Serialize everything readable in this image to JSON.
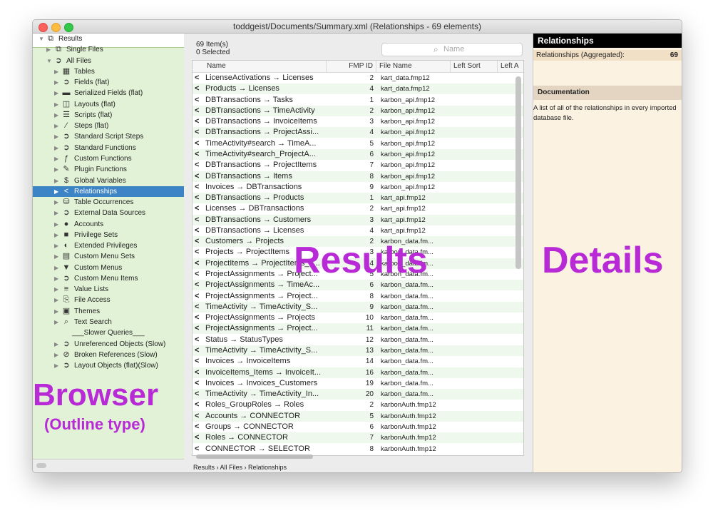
{
  "window": {
    "title": "toddgeist/Documents/Summary.xml  (Relationships - 69 elements)"
  },
  "browser": {
    "items": [
      {
        "label": "Results",
        "icon": "layers-icon",
        "indent": 0,
        "tri": "▼"
      },
      {
        "label": "Single Files",
        "icon": "layers-icon",
        "indent": 1,
        "tri": "▶"
      },
      {
        "label": "All Files",
        "icon": "circle-arrow-icon",
        "indent": 1,
        "tri": "▼"
      },
      {
        "label": "Tables",
        "icon": "table-icon",
        "indent": 2,
        "tri": "▶"
      },
      {
        "label": "Fields (flat)",
        "icon": "circle-arrow-icon",
        "indent": 2,
        "tri": "▶"
      },
      {
        "label": "Serialized Fields (flat)",
        "icon": "field-icon",
        "indent": 2,
        "tri": "▶"
      },
      {
        "label": "Layouts (flat)",
        "icon": "layout-icon",
        "indent": 2,
        "tri": "▶"
      },
      {
        "label": "Scripts (flat)",
        "icon": "script-icon",
        "indent": 2,
        "tri": "▶"
      },
      {
        "label": "Steps (flat)",
        "icon": "pen-icon",
        "indent": 2,
        "tri": "▶"
      },
      {
        "label": "Standard Script Steps",
        "icon": "circle-arrow-icon",
        "indent": 2,
        "tri": "▶"
      },
      {
        "label": "Standard Functions",
        "icon": "circle-arrow-icon",
        "indent": 2,
        "tri": "▶"
      },
      {
        "label": "Custom Functions",
        "icon": "function-icon",
        "indent": 2,
        "tri": "▶"
      },
      {
        "label": "Plugin Functions",
        "icon": "plugin-icon",
        "indent": 2,
        "tri": "▶"
      },
      {
        "label": "Global Variables",
        "icon": "dollar-icon",
        "indent": 2,
        "tri": "▶"
      },
      {
        "label": "Relationships",
        "icon": "relationship-icon",
        "indent": 2,
        "tri": "▶",
        "selected": true
      },
      {
        "label": "Table Occurrences",
        "icon": "database-icon",
        "indent": 2,
        "tri": "▶"
      },
      {
        "label": "External Data Sources",
        "icon": "circle-arrow-icon",
        "indent": 2,
        "tri": "▶"
      },
      {
        "label": "Accounts",
        "icon": "person-icon",
        "indent": 2,
        "tri": "▶"
      },
      {
        "label": "Privilege Sets",
        "icon": "lock-icon",
        "indent": 2,
        "tri": "▶"
      },
      {
        "label": "Extended Privileges",
        "icon": "toggle-icon",
        "indent": 2,
        "tri": "▶"
      },
      {
        "label": "Custom Menu Sets",
        "icon": "menu-set-icon",
        "indent": 2,
        "tri": "▶"
      },
      {
        "label": "Custom Menus",
        "icon": "chevron-down-icon",
        "indent": 2,
        "tri": "▶"
      },
      {
        "label": "Custom Menu Items",
        "icon": "circle-arrow-icon",
        "indent": 2,
        "tri": "▶"
      },
      {
        "label": "Value Lists",
        "icon": "list-icon",
        "indent": 2,
        "tri": "▶"
      },
      {
        "label": "File Access",
        "icon": "file-access-icon",
        "indent": 2,
        "tri": "▶"
      },
      {
        "label": "Themes",
        "icon": "theme-icon",
        "indent": 2,
        "tri": "▶"
      },
      {
        "label": "Text Search",
        "icon": "search-icon",
        "indent": 2,
        "tri": "▶"
      },
      {
        "label": "___Slower Queries___",
        "icon": "",
        "indent": 3,
        "tri": ""
      },
      {
        "label": "Unreferenced Objects (Slow)",
        "icon": "circle-arrow-icon",
        "indent": 2,
        "tri": "▶"
      },
      {
        "label": "Broken References (Slow)",
        "icon": "broken-icon",
        "indent": 2,
        "tri": "▶"
      },
      {
        "label": "Layout Objects (flat)(Slow)",
        "icon": "circle-arrow-icon",
        "indent": 2,
        "tri": "▶"
      }
    ]
  },
  "icons": {
    "layers-icon": "⧉",
    "circle-arrow-icon": "➲",
    "table-icon": "▦",
    "field-icon": "▬",
    "layout-icon": "◫",
    "script-icon": "☰",
    "pen-icon": "⁄",
    "function-icon": "ƒ",
    "plugin-icon": "✎",
    "dollar-icon": "$",
    "relationship-icon": "<",
    "database-icon": "⛁",
    "person-icon": "●",
    "lock-icon": "■",
    "toggle-icon": "◐",
    "menu-set-icon": "▤",
    "chevron-down-icon": "▼",
    "list-icon": "≡",
    "file-access-icon": "⎘",
    "theme-icon": "▣",
    "search-icon": "⌕",
    "broken-icon": "⊘"
  },
  "results": {
    "count_label": "69 Item(s)",
    "selected_label": "0 Selected",
    "search_placeholder": "Name",
    "columns": [
      "Name",
      "FMP ID",
      "File Name",
      "Left Sort",
      "Left A"
    ],
    "rows": [
      [
        "LicenseActivations → Licenses",
        "2",
        "kart_data.fmp12"
      ],
      [
        "Products → Licenses",
        "4",
        "kart_data.fmp12"
      ],
      [
        "DBTransactions → Tasks",
        "1",
        "karbon_api.fmp12"
      ],
      [
        "DBTransactions → TimeActivity",
        "2",
        "karbon_api.fmp12"
      ],
      [
        "DBTransactions → InvoiceItems",
        "3",
        "karbon_api.fmp12"
      ],
      [
        "DBTransactions → ProjectAssi...",
        "4",
        "karbon_api.fmp12"
      ],
      [
        "TimeActivity#search → TimeA...",
        "5",
        "karbon_api.fmp12"
      ],
      [
        "TimeActivity#search_ProjectA...",
        "6",
        "karbon_api.fmp12"
      ],
      [
        "DBTransactions → ProjectItems",
        "7",
        "karbon_api.fmp12"
      ],
      [
        "DBTransactions → Items",
        "8",
        "karbon_api.fmp12"
      ],
      [
        "Invoices → DBTransactions",
        "9",
        "karbon_api.fmp12"
      ],
      [
        "DBTransactions → Products",
        "1",
        "kart_api.fmp12"
      ],
      [
        "Licenses → DBTransactions",
        "2",
        "kart_api.fmp12"
      ],
      [
        "DBTransactions → Customers",
        "3",
        "kart_api.fmp12"
      ],
      [
        "DBTransactions → Licenses",
        "4",
        "kart_api.fmp12"
      ],
      [
        "Customers → Projects",
        "2",
        "karbon_data.fm..."
      ],
      [
        "Projects → ProjectItems",
        "3",
        "karbon_data.fm..."
      ],
      [
        "ProjectItems → ProjectItems_It...",
        "4",
        "karbon_data.fm..."
      ],
      [
        "ProjectAssignments → Project...",
        "5",
        "karbon_data.fm..."
      ],
      [
        "ProjectAssignments → TimeAc...",
        "6",
        "karbon_data.fm..."
      ],
      [
        "ProjectAssignments → Project...",
        "8",
        "karbon_data.fm..."
      ],
      [
        "TimeActivity → TimeActivity_S...",
        "9",
        "karbon_data.fm..."
      ],
      [
        "ProjectAssignments → Projects",
        "10",
        "karbon_data.fm..."
      ],
      [
        "ProjectAssignments → Project...",
        "11",
        "karbon_data.fm..."
      ],
      [
        "Status → StatusTypes",
        "12",
        "karbon_data.fm..."
      ],
      [
        "TimeActivity → TimeActivity_S...",
        "13",
        "karbon_data.fm..."
      ],
      [
        "Invoices → InvoiceItems",
        "14",
        "karbon_data.fm..."
      ],
      [
        "InvoiceItems_Items → InvoiceIt...",
        "16",
        "karbon_data.fm..."
      ],
      [
        "Invoices → Invoices_Customers",
        "19",
        "karbon_data.fm..."
      ],
      [
        "TimeActivity → TimeActivity_In...",
        "20",
        "karbon_data.fm..."
      ],
      [
        "Roles_GroupRoles → Roles",
        "2",
        "karbonAuth.fmp12"
      ],
      [
        "Accounts → CONNECTOR",
        "5",
        "karbonAuth.fmp12"
      ],
      [
        "Groups → CONNECTOR",
        "6",
        "karbonAuth.fmp12"
      ],
      [
        "Roles → CONNECTOR",
        "7",
        "karbonAuth.fmp12"
      ],
      [
        "CONNECTOR → SELECTOR",
        "8",
        "karbonAuth.fmp12"
      ]
    ],
    "breadcrumb": "Results  ›  All Files  ›  Relationships"
  },
  "details": {
    "header": "Relationships",
    "stat_label": "Relationships (Aggregated):",
    "stat_value": "69",
    "doc_header": "Documentation",
    "doc_text": "A list of all of the relationships in every imported database file."
  },
  "annotations": {
    "browser": "Browser",
    "browser_sub": "(Outline type)",
    "results": "Results",
    "details": "Details"
  }
}
